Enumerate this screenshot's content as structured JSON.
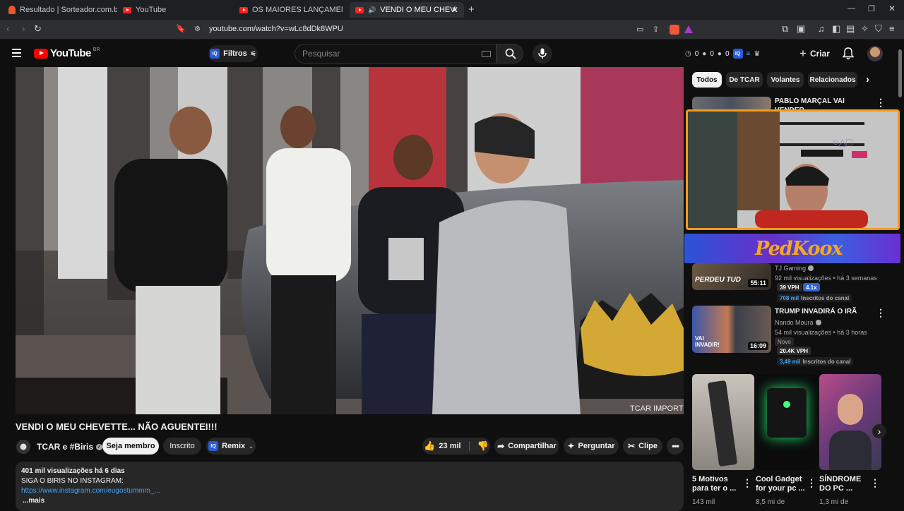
{
  "browser": {
    "tabs": [
      {
        "label": "Resultado | Sorteador.com.br - O Site"
      },
      {
        "label": "YouTube"
      },
      {
        "label": "OS MAIORES LANÇAMENTOS DO CINEMA"
      },
      {
        "label": "VENDI O MEU CHEVETTE... NÃO AGUENTEI!!!"
      }
    ],
    "new_tab": "+",
    "url": "youtube.com/watch?v=wLc8dDk8WPU"
  },
  "masthead": {
    "logo": "YouTube",
    "region": "BR",
    "filters_label": "Filtros",
    "search_placeholder": "Pesquisar",
    "counters": [
      "0",
      "0",
      "0"
    ],
    "create_label": "Criar"
  },
  "video": {
    "title": "VENDI O MEU CHEVETTE... NÃO AGUENTEI!!!",
    "watermark": "TCAR IMPORTS"
  },
  "channel": {
    "name": "TCAR e #Biris",
    "member_button": "Seja membro",
    "subscribed_button": "Inscrito",
    "remix_label": "Remix"
  },
  "actions": {
    "likes": "23 mil",
    "share": "Compartilhar",
    "ask": "Perguntar",
    "clip": "Clipe"
  },
  "description": {
    "stats": "401 mil visualizações  há 6 dias",
    "line1": "SIGA O BIRIS NO INSTAGRAM:",
    "link": "https://www.instagram.com/eugostummm_...",
    "more": "...mais"
  },
  "sidebar": {
    "chips": [
      "Todos",
      "De TCAR",
      "Volantes",
      "Relacionados"
    ],
    "videos": [
      {
        "title": "PABLO MARÇAL VAI VENDER"
      },
      {
        "title": "",
        "channel": "TJ Gaming",
        "meta": "92 mil visualizações • há 3 semanas",
        "duration": "55:11",
        "thumb_text": "PERDEU TUD",
        "vph": "39 VPH",
        "ratio": "4.1x",
        "subs_value": "708 mil",
        "subs_label": "Inscritos do canal"
      },
      {
        "title": "TRUMP INVADIRÁ O IRÃ",
        "channel": "Nando Moura",
        "meta": "54 mil visualizações • há 3 horas",
        "duration": "16:09",
        "thumb_text": "VAI INVADIR!",
        "new_badge": "Novo",
        "vph": "20.4K VPH",
        "subs_value": "3,49 mil",
        "subs_label": "Inscritos do canal"
      }
    ],
    "webcam_banner": "PedKoox",
    "shorts": [
      {
        "title": "5 Motivos para ter o ...",
        "meta": "143 mil"
      },
      {
        "title": "Cool Gadget for your pc ...",
        "meta": "8,5 mi de"
      },
      {
        "title": "SÍNDROME DO PC ...",
        "meta": "1,3 mi de"
      }
    ]
  },
  "colors": {
    "yt_red": "#ff0000",
    "accent_blue": "#3ea6ff",
    "webcam_border": "#f59b1b"
  }
}
